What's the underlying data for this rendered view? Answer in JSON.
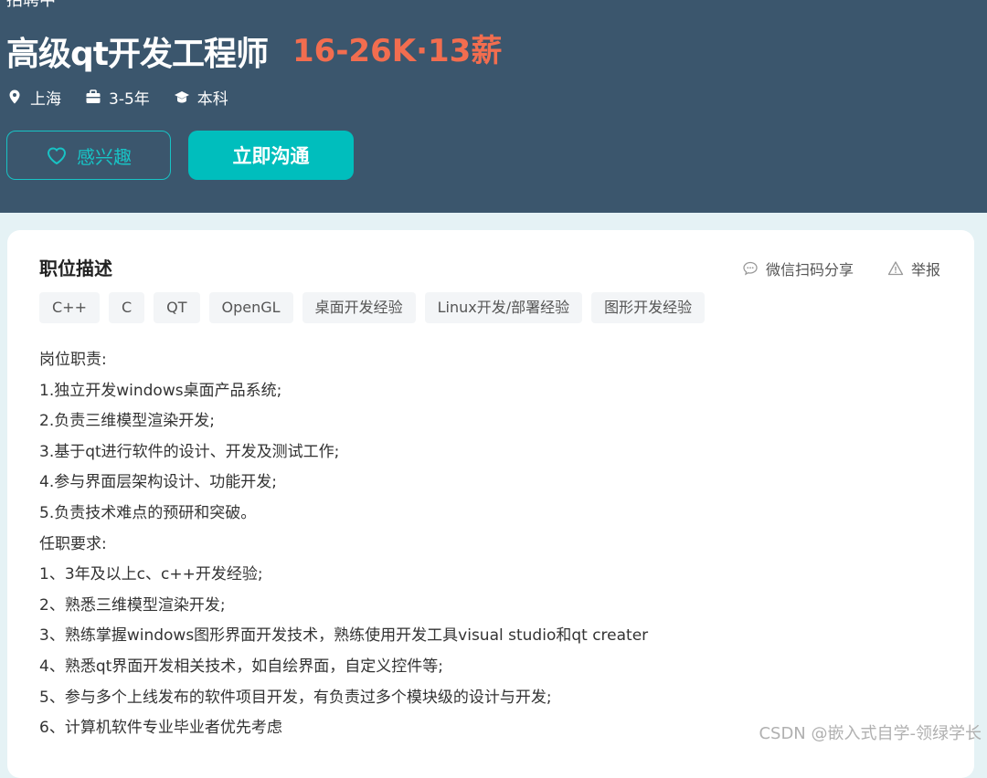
{
  "header": {
    "status_label": "招聘中",
    "job_title": "高级qt开发工程师",
    "salary": "16-26K·13薪",
    "meta": {
      "location": "上海",
      "experience": "3-5年",
      "degree": "本科"
    },
    "interest_label": "感兴趣",
    "chat_label": "立即沟通"
  },
  "card": {
    "section_title": "职位描述",
    "share_label": "微信扫码分享",
    "report_label": "举报",
    "tags": [
      "C++",
      "C",
      "QT",
      "OpenGL",
      "桌面开发经验",
      "Linux开发/部署经验",
      "图形开发经验"
    ],
    "description": [
      "岗位职责:",
      "1.独立开发windows桌面产品系统;",
      "2.负责三维模型渲染开发;",
      "3.基于qt进行软件的设计、开发及测试工作;",
      "4.参与界面层架构设计、功能开发;",
      "5.负责技术难点的预研和突破。",
      "任职要求:",
      "1、3年及以上c、c++开发经验;",
      "2、熟悉三维模型渲染开发;",
      "3、熟练掌握windows图形界面开发技术，熟练使用开发工具visual studio和qt creater",
      "4、熟悉qt界面开发相关技术，如自绘界面，自定义控件等;",
      "5、参与多个上线发布的软件项目开发，有负责过多个模块级的设计与开发;",
      "6、计算机软件专业毕业者优先考虑"
    ]
  },
  "watermark": "CSDN @嵌入式自学-领绿学长",
  "colors": {
    "header_bg": "#3b566d",
    "salary": "#f26d4f",
    "accent": "#00bebd",
    "page_bg": "#e5f2f5"
  }
}
